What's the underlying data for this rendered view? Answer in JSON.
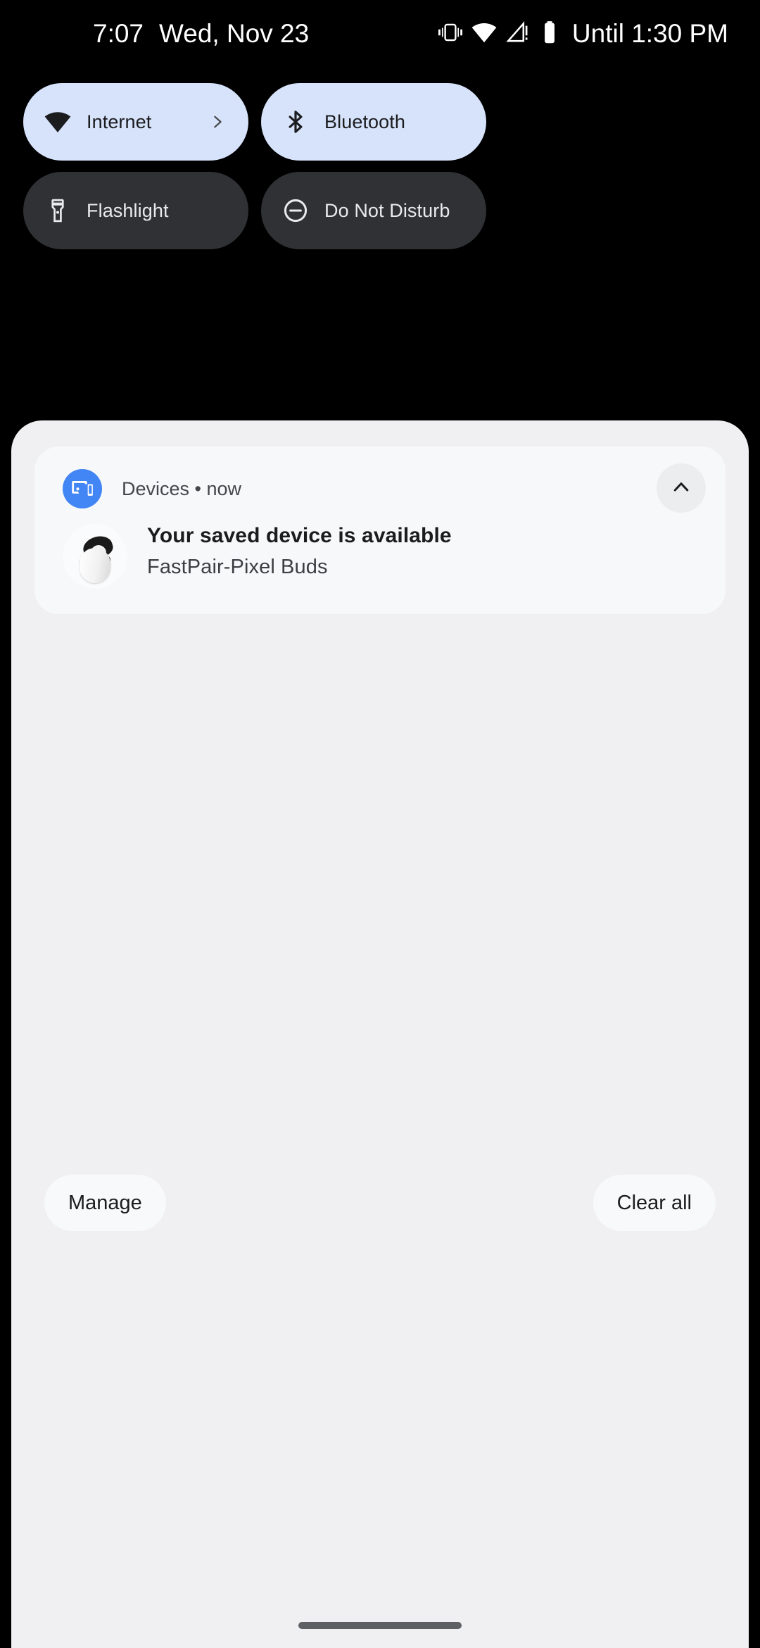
{
  "status_bar": {
    "clock": "7:07",
    "date": "Wed, Nov 23",
    "until_label": "Until 1:30 PM",
    "icons": [
      {
        "name": "vibrate-icon"
      },
      {
        "name": "wifi-icon"
      },
      {
        "name": "cell-signal-alert-icon"
      },
      {
        "name": "battery-icon"
      }
    ],
    "text_color": "#ffffff",
    "background": "#000000"
  },
  "quick_settings": {
    "tiles": [
      {
        "label": "Internet",
        "icon": "wifi-icon",
        "state": "on",
        "has_chevron": true
      },
      {
        "label": "Bluetooth",
        "icon": "bluetooth-icon",
        "state": "on",
        "has_chevron": false
      },
      {
        "label": "Flashlight",
        "icon": "flashlight-icon",
        "state": "off",
        "has_chevron": false
      },
      {
        "label": "Do Not Disturb",
        "icon": "do-not-disturb-icon",
        "state": "off",
        "has_chevron": false
      }
    ],
    "on_background": "#d6e3fb",
    "on_foreground": "#1b1c1e",
    "off_background": "#303134",
    "off_foreground": "#e9eaec"
  },
  "shade": {
    "background": "#f0f0f2",
    "notification": {
      "card_background": "#f7f8f9",
      "app_name": "Devices",
      "separator": "•",
      "time": "now",
      "app_line": "Devices • now",
      "app_icon": "devices-cast-icon",
      "app_icon_color": "#4285f4",
      "collapse_icon": "chevron-up-icon",
      "thumbnail": "pixel-buds-case-image",
      "title": "Your saved device is available",
      "subtitle": "FastPair-Pixel Buds"
    },
    "footer": {
      "manage_label": "Manage",
      "clear_all_label": "Clear all"
    }
  },
  "navigation": {
    "gesture_pill": "home-gesture-pill",
    "pill_color": "#5f6063"
  }
}
